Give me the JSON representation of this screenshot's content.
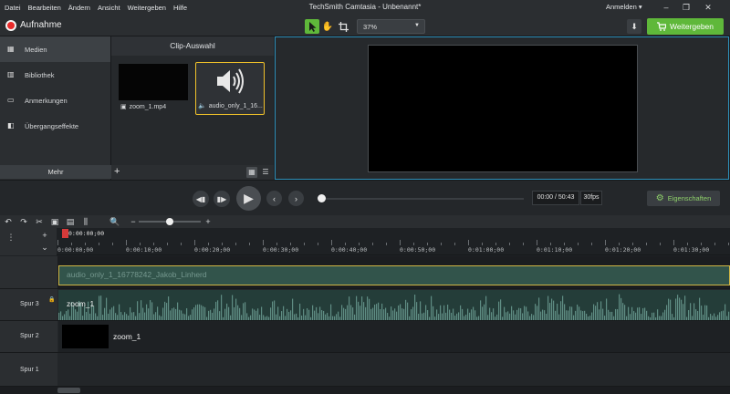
{
  "menu": [
    "Datei",
    "Bearbeiten",
    "Ändern",
    "Ansicht",
    "Weitergeben",
    "Hilfe"
  ],
  "window_title": "TechSmith Camtasia - Unbenannt*",
  "account": {
    "label": "Anmelden ▾"
  },
  "toolbar": {
    "record_label": "Aufnahme",
    "zoom_value": "37%",
    "share_label": "Weitergeben"
  },
  "left_nav": {
    "items": [
      {
        "label": "Medien",
        "icon": "film-icon",
        "active": true
      },
      {
        "label": "Bibliothek",
        "icon": "library-icon",
        "active": false
      },
      {
        "label": "Anmerkungen",
        "icon": "annotation-icon",
        "active": false
      },
      {
        "label": "Übergangseffekte",
        "icon": "transition-icon",
        "active": false
      }
    ],
    "more_label": "Mehr"
  },
  "clip_bin": {
    "title": "Clip-Auswahl",
    "clips": [
      {
        "label": "zoom_1.mp4",
        "kind": "video"
      },
      {
        "label": "audio_only_1_16...",
        "kind": "audio",
        "selected": true
      }
    ]
  },
  "playback": {
    "time": "00:00 / 50:43",
    "fps": "30fps",
    "properties_label": "Eigenschaften"
  },
  "ruler": {
    "playhead": "0:00:00;00",
    "ticks": [
      "0:00:00;00",
      "0:00:10;00",
      "0:00:20;00",
      "0:00:30;00",
      "0:00:40;00",
      "0:00:50;00",
      "0:01:00;00",
      "0:01:10;00",
      "0:01:20;00",
      "0:01:30;00"
    ]
  },
  "tracks": {
    "ghost_clip": "audio_only_1_16778242_Jakob_Linherd",
    "spur3": {
      "name": "Spur 3",
      "clip": "zoom_1"
    },
    "spur2": {
      "name": "Spur 2",
      "clip": "zoom_1"
    },
    "spur1": {
      "name": "Spur 1"
    }
  },
  "colors": {
    "accent": "#5fb83a",
    "selection": "#f0c22a",
    "record": "#e82b2b",
    "canvas_border": "#2d8fb8"
  }
}
